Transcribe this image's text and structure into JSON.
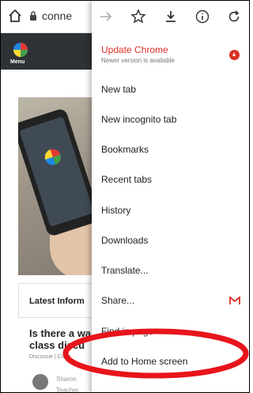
{
  "address_bar": {
    "url": "conne"
  },
  "site": {
    "menu_label": "Menu",
    "latest_label": "Latest Inform",
    "post_title": "Is there a wa class discu",
    "post_meta": "Discussie | Conn",
    "author_name": "Sharon",
    "author_role": "Teacher"
  },
  "toolbar": {
    "icons": [
      "arrow-forward-icon",
      "star-icon",
      "download-icon",
      "info-icon",
      "refresh-icon"
    ]
  },
  "menu": {
    "update_title": "Update Chrome",
    "update_subtitle": "Newer version is available",
    "items": [
      {
        "label": "New tab"
      },
      {
        "label": "New incognito tab"
      },
      {
        "label": "Bookmarks"
      },
      {
        "label": "Recent tabs"
      },
      {
        "label": "History"
      },
      {
        "label": "Downloads"
      },
      {
        "label": "Translate..."
      },
      {
        "label": "Share..."
      },
      {
        "label": "Find in page"
      },
      {
        "label": "Add to Home screen"
      }
    ]
  },
  "colors": {
    "accent_red": "#d93025",
    "highlight_red": "#e8141b",
    "site_header": "#2e3135"
  }
}
